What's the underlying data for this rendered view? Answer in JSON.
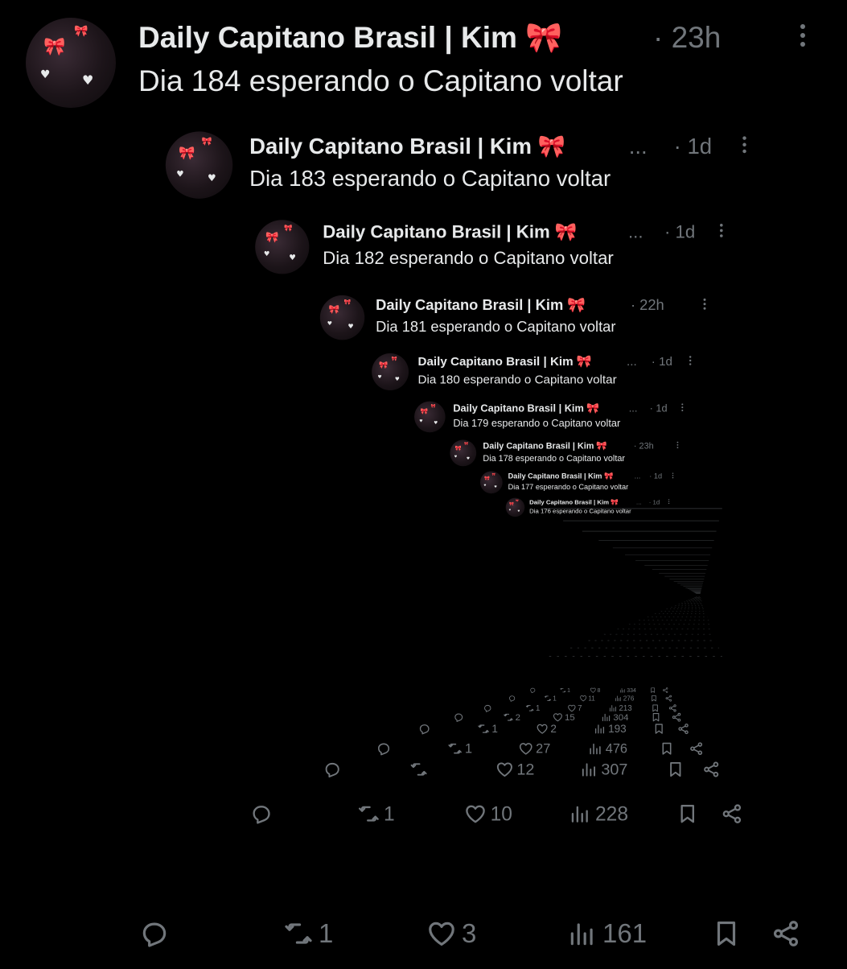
{
  "theme": {
    "background": "#000000",
    "text": "#e7e9ea",
    "muted": "#71767b",
    "bow_color": "#ff8fc4"
  },
  "icons": {
    "reply": "reply-icon",
    "repost": "repost-icon",
    "like": "heart-icon",
    "views": "views-icon",
    "bookmark": "bookmark-icon",
    "share": "share-icon",
    "more": "more-icon"
  },
  "tweets": [
    {
      "name": "Daily Capitano Brasil | Kim 🎀",
      "truncated": "",
      "time": "· 23h",
      "text": "Dia 184 esperando o Capitano voltar",
      "reply": "",
      "repost": "1",
      "like": "3",
      "views": "161"
    },
    {
      "name": "Daily Capitano Brasil | Kim 🎀",
      "truncated": "...",
      "time": "· 1d",
      "text": "Dia 183 esperando o Capitano voltar",
      "reply": "",
      "repost": "1",
      "like": "10",
      "views": "228"
    },
    {
      "name": "Daily Capitano Brasil | Kim 🎀",
      "truncated": "...",
      "time": "· 1d",
      "text": "Dia 182 esperando o Capitano voltar",
      "reply": "",
      "repost": "",
      "like": "12",
      "views": "307"
    },
    {
      "name": "Daily Capitano Brasil | Kim 🎀",
      "truncated": "",
      "time": "· 22h",
      "text": "Dia 181 esperando o Capitano voltar",
      "reply": "",
      "repost": "1",
      "like": "27",
      "views": "476"
    },
    {
      "name": "Daily Capitano Brasil | Kim 🎀",
      "truncated": "...",
      "time": "· 1d",
      "text": "Dia 180 esperando o Capitano voltar",
      "reply": "",
      "repost": "1",
      "like": "2",
      "views": "193"
    },
    {
      "name": "Daily Capitano Brasil | Kim 🎀",
      "truncated": "...",
      "time": "· 1d",
      "text": "Dia 179 esperando o Capitano voltar",
      "reply": "",
      "repost": "2",
      "like": "15",
      "views": "304"
    },
    {
      "name": "Daily Capitano Brasil | Kim 🎀",
      "truncated": "",
      "time": "· 23h",
      "text": "Dia 178 esperando o Capitano voltar",
      "reply": "",
      "repost": "1",
      "like": "7",
      "views": "213"
    },
    {
      "name": "Daily Capitano Brasil | Kim 🎀",
      "truncated": "...",
      "time": "· 1d",
      "text": "Dia 177 esperando o Capitano voltar",
      "reply": "",
      "repost": "1",
      "like": "11",
      "views": "276"
    },
    {
      "name": "Daily Capitano Brasil | Kim 🎀",
      "truncated": "...",
      "time": "· 1d",
      "text": "Dia 176 esperando o Capitano voltar",
      "reply": "",
      "repost": "1",
      "like": "8",
      "views": "334"
    }
  ]
}
